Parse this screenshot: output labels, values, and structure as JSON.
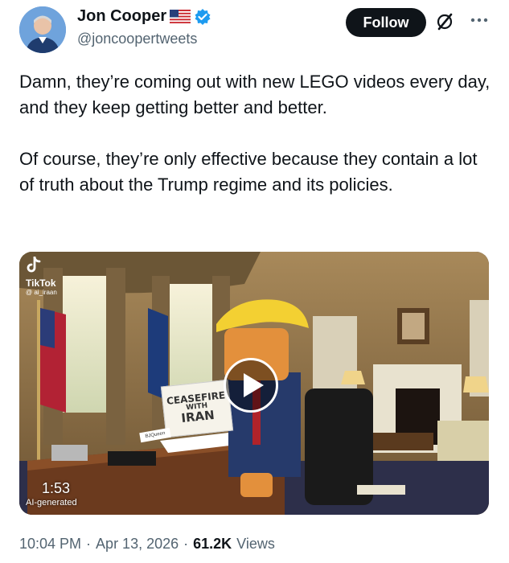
{
  "author": {
    "name": "Jon Cooper",
    "handle": "@joncoopertweets",
    "flag_icon": "us-flag-icon",
    "verified_icon": "verified-badge-icon"
  },
  "actions": {
    "follow_label": "Follow",
    "grok_icon": "grok-icon",
    "more_icon": "more-options-icon"
  },
  "tweet": {
    "paragraphs": [
      "Damn, they’re coming out with new LEGO videos every day, and they keep getting better and better.",
      "Of course, they’re only effective because they contain a lot of truth about the Trump regime and its policies."
    ]
  },
  "media": {
    "tiktok_label": "TikTok",
    "tiktok_user": "@ ai_iraan",
    "sign_line1": "CEASEFIRE",
    "sign_line2": "WITH",
    "sign_line3": "IRAN",
    "nameplate": "BJQueen",
    "duration": "1:53",
    "ai_label": "AI-generated"
  },
  "meta": {
    "time": "10:04 PM",
    "separator": "·",
    "date": "Apr 13, 2026",
    "views_count": "61.2K",
    "views_label": "Views"
  },
  "colors": {
    "text": "#0f1419",
    "secondary": "#536471",
    "follow_bg": "#0f1419",
    "verified": "#1d9bf0"
  }
}
